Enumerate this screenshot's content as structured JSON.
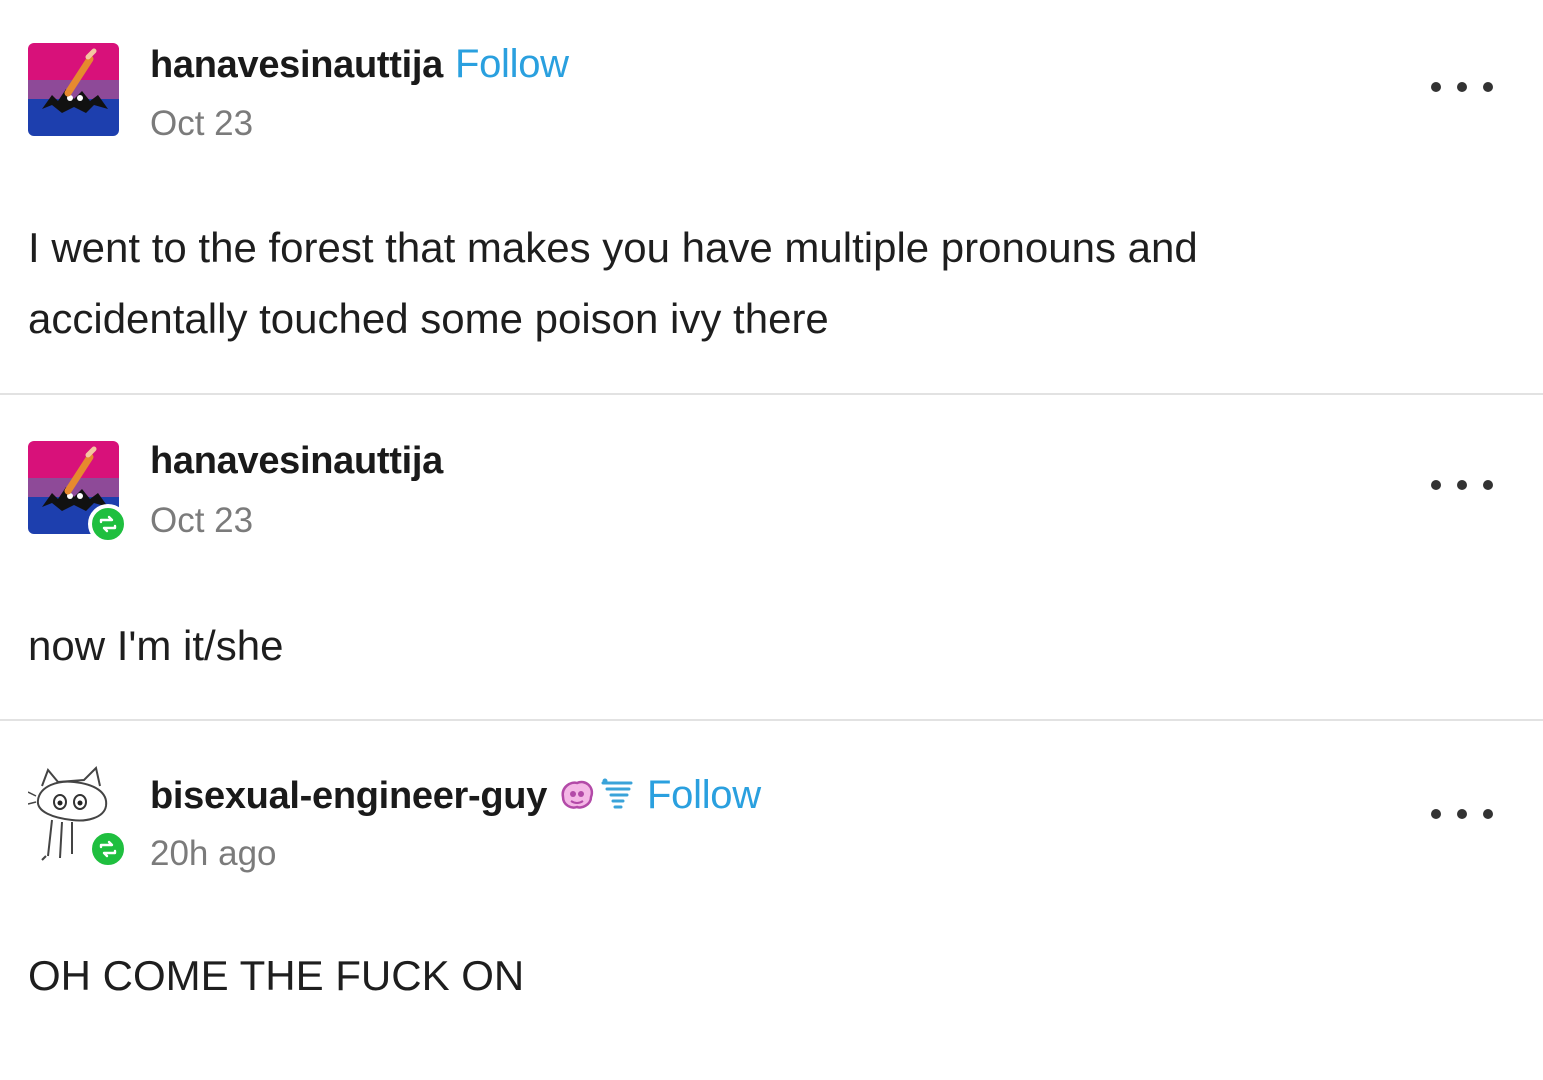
{
  "posts": [
    {
      "username": "hanavesinauttija",
      "follow_label": "Follow",
      "date": "Oct 23",
      "body_lines": [
        "I went to the forest that makes you have multiple pronouns and",
        "accidentally touched some poison ivy there"
      ],
      "avatar": "bi-flag-bat-avatar",
      "reblogged": false
    },
    {
      "username": "hanavesinauttija",
      "date": "Oct 23",
      "body_lines": [
        "now I'm it/she"
      ],
      "avatar": "bi-flag-bat-avatar",
      "reblogged": true
    },
    {
      "username": "bisexual-engineer-guy",
      "follow_label": "Follow",
      "date": "20h ago",
      "body_lines": [
        "OH COME THE FUCK ON"
      ],
      "avatar": "cat-sketch-avatar",
      "badges": [
        "purple-brain-badge-icon",
        "blue-tornado-badge-icon"
      ],
      "reblogged": true
    }
  ],
  "colors": {
    "follow": "#2aa0df",
    "reblog_badge": "#1fbf3f",
    "date_text": "#7b7b7b",
    "divider": "#e2e2e2"
  }
}
